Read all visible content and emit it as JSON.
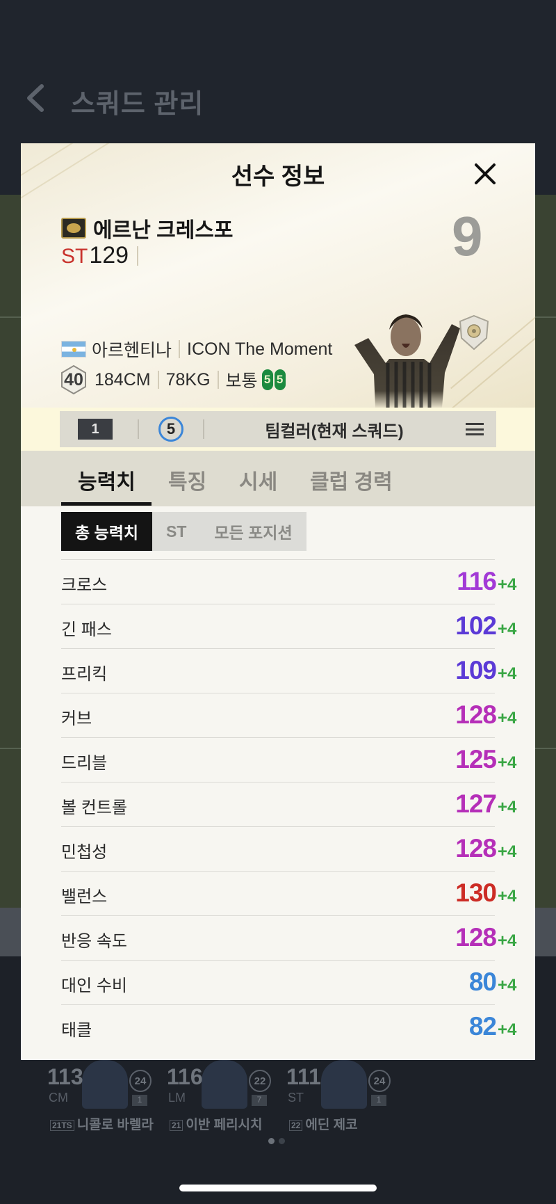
{
  "background": {
    "title": "스쿼드 관리",
    "players": [
      {
        "ovr": "113",
        "pos": "CM",
        "badge": "24",
        "num": "1",
        "year": "21TS",
        "name": "니콜로 바렐라"
      },
      {
        "ovr": "116",
        "pos": "LM",
        "badge": "22",
        "num": "7",
        "year": "21",
        "name": "이반 페리시치"
      },
      {
        "ovr": "111",
        "pos": "ST",
        "badge": "24",
        "num": "1",
        "year": "22",
        "name": "에딘 제코"
      }
    ]
  },
  "modal": {
    "title": "선수 정보",
    "player": {
      "name": "에르난 크레스포",
      "position": "ST",
      "ovr": "129",
      "jersey": "9",
      "nation": "아르헨티나",
      "season": "ICON The Moment",
      "pay": "40",
      "height": "184CM",
      "weight": "78KG",
      "body_type": "보통",
      "weak_foot": "5",
      "strong_foot": "5"
    },
    "toolbar": {
      "level": "1",
      "enhance": "5",
      "team": "팀컬러(현재 스쿼드)"
    },
    "tabs": [
      {
        "label": "능력치"
      },
      {
        "label": "특징"
      },
      {
        "label": "시세"
      },
      {
        "label": "클럽 경력"
      }
    ],
    "subtabs": [
      {
        "label": "총 능력치"
      },
      {
        "label": "ST"
      },
      {
        "label": "모든 포지션"
      }
    ],
    "stats": [
      {
        "name": "크로스",
        "value": "116",
        "bonus": "+4",
        "color": "#a23ad6"
      },
      {
        "name": "긴 패스",
        "value": "102",
        "bonus": "+4",
        "color": "#5b3ad6"
      },
      {
        "name": "프리킥",
        "value": "109",
        "bonus": "+4",
        "color": "#5b3ad6"
      },
      {
        "name": "커브",
        "value": "128",
        "bonus": "+4",
        "color": "#b52fb8"
      },
      {
        "name": "드리블",
        "value": "125",
        "bonus": "+4",
        "color": "#b52fb8"
      },
      {
        "name": "볼 컨트롤",
        "value": "127",
        "bonus": "+4",
        "color": "#b52fb8"
      },
      {
        "name": "민첩성",
        "value": "128",
        "bonus": "+4",
        "color": "#b52fb8"
      },
      {
        "name": "밸런스",
        "value": "130",
        "bonus": "+4",
        "color": "#cc2c25"
      },
      {
        "name": "반응 속도",
        "value": "128",
        "bonus": "+4",
        "color": "#b52fb8"
      },
      {
        "name": "대인 수비",
        "value": "80",
        "bonus": "+4",
        "color": "#3b86d8"
      },
      {
        "name": "태클",
        "value": "82",
        "bonus": "+4",
        "color": "#3b86d8"
      }
    ]
  }
}
